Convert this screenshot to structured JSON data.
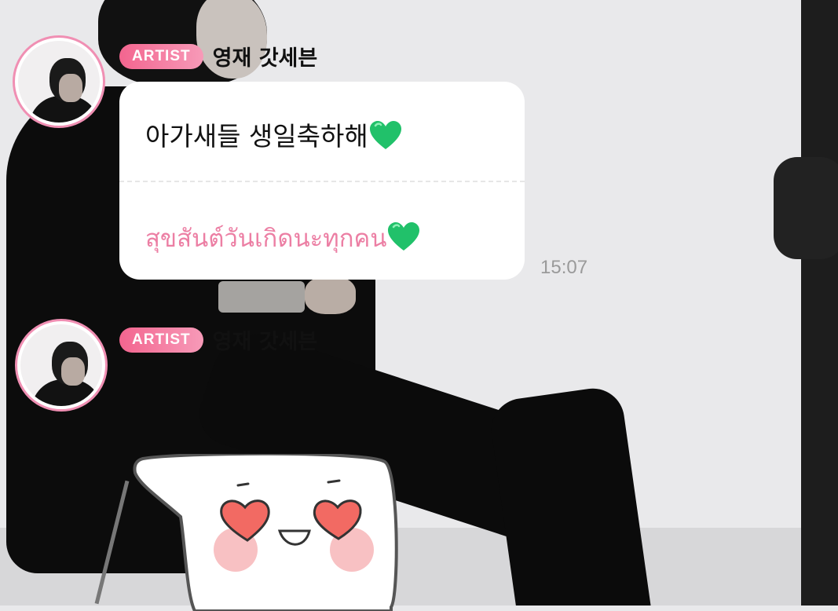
{
  "messages": [
    {
      "badge": "ARTIST",
      "sender": "영재 갓세븐",
      "text_ko": "아가새들 생일축하해",
      "text_th": "สุขสันต์วันเกิดนะทุกคน",
      "emoji": "green-heart-icon",
      "time": "15:07"
    },
    {
      "badge": "ARTIST",
      "sender": "영재 갓세븐",
      "sticker": "heart-eyes-smile-sticker"
    }
  ],
  "colors": {
    "badge_gradient_start": "#f3658f",
    "badge_gradient_end": "#f79ab8",
    "avatar_ring": "#f08fb3",
    "translation_text": "#ec7fa4",
    "time_text": "#9a9a9a",
    "heart_emoji": "#21c16a"
  }
}
